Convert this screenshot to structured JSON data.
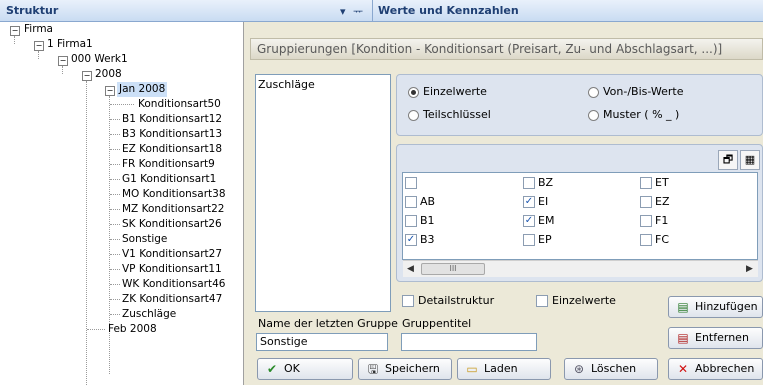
{
  "left_panel": {
    "title": "Struktur",
    "controls": "▾ ⊥"
  },
  "tree": {
    "items": [
      {
        "label": "Firma",
        "toggle": "−"
      },
      {
        "label": "1 Firma1",
        "toggle": "−"
      },
      {
        "label": "000 Werk1",
        "toggle": "−"
      },
      {
        "label": "2008",
        "toggle": "−"
      },
      {
        "label": "Jan 2008",
        "toggle": "−"
      },
      {
        "label": "Konditionsart50"
      },
      {
        "label": "B1 Konditionsart12"
      },
      {
        "label": "B3 Konditionsart13"
      },
      {
        "label": "EZ Konditionsart18"
      },
      {
        "label": "FR Konditionsart9"
      },
      {
        "label": "G1 Konditionsart1"
      },
      {
        "label": "MO Konditionsart38"
      },
      {
        "label": "MZ Konditionsart22"
      },
      {
        "label": "SK Konditionsart26"
      },
      {
        "label": "Sonstige"
      },
      {
        "label": "V1 Konditionsart27"
      },
      {
        "label": "VP Konditionsart11"
      },
      {
        "label": "WK Konditionsart46"
      },
      {
        "label": "ZK Konditionsart47"
      },
      {
        "label": "Zuschläge"
      },
      {
        "label": "Feb 2008"
      }
    ]
  },
  "right_panel": {
    "title": "Werte und Kennzahlen",
    "group_bar": "Gruppierungen [Kondition - Konditionsart (Preisart, Zu- und Abschlagsart, ...)]",
    "group_list_item": "Zuschläge",
    "radios": {
      "einzelwerte": "Einzelwerte",
      "von_bis": "Von-/Bis-Werte",
      "teilschluessel": "Teilschlüssel",
      "muster": "Muster ( % _ )"
    },
    "checks": {
      "col1": [
        {
          "label": "",
          "checked": false
        },
        {
          "label": "AB",
          "checked": false
        },
        {
          "label": "B1",
          "checked": false
        },
        {
          "label": "B3",
          "checked": true
        }
      ],
      "col2": [
        {
          "label": "BZ",
          "checked": false
        },
        {
          "label": "EI",
          "checked": true
        },
        {
          "label": "EM",
          "checked": true
        },
        {
          "label": "EP",
          "checked": false
        }
      ],
      "col3": [
        {
          "label": "ET",
          "checked": false
        },
        {
          "label": "EZ",
          "checked": false
        },
        {
          "label": "F1",
          "checked": false
        },
        {
          "label": "FC",
          "checked": false
        }
      ]
    },
    "scroll_thumb": "III",
    "detailstruktur": "Detailstruktur",
    "einzelwerte_check": "Einzelwerte",
    "last_group_label": "Name der letzten Gruppe",
    "last_group_value": "Sonstige",
    "group_title_label": "Gruppentitel",
    "group_title_value": "",
    "buttons": {
      "hinzufuegen": "Hinzufügen",
      "entfernen": "Entfernen",
      "ok": "OK",
      "speichern": "Speichern",
      "laden": "Laden",
      "loeschen": "Löschen",
      "abbrechen": "Abbrechen"
    }
  }
}
